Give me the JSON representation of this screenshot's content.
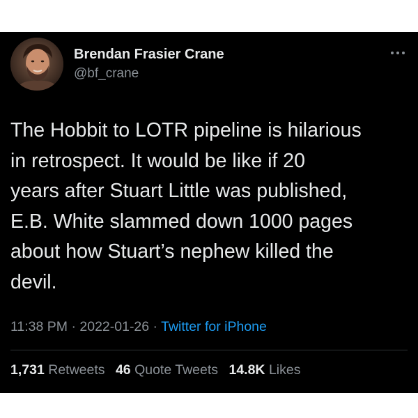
{
  "author": {
    "name": "Brendan Frasier Crane",
    "handle": "@bf_crane",
    "avatar_icon": "avatar-photo"
  },
  "more_icon": "more-options-icon",
  "tweet": {
    "lines": [
      "The Hobbit to LOTR pipeline is hilarious",
      "in retrospect. It would be like if 20",
      "years after Stuart Little was published,",
      "E.B. White slammed down 1000 pages",
      "about how Stuart’s nephew killed the",
      "devil."
    ],
    "time": "11:38 PM",
    "separator": "·",
    "date": "2022-01-26",
    "source": "Twitter for iPhone"
  },
  "stats": {
    "retweets_count": "1,731",
    "retweets_label": "Retweets",
    "quotes_count": "46",
    "quotes_label": "Quote Tweets",
    "likes_count": "14.8K",
    "likes_label": "Likes"
  },
  "colors": {
    "background": "#000000",
    "text": "#e7e9ea",
    "secondary": "#8b9197",
    "link": "#1d9bf0",
    "divider": "#2f3336"
  }
}
